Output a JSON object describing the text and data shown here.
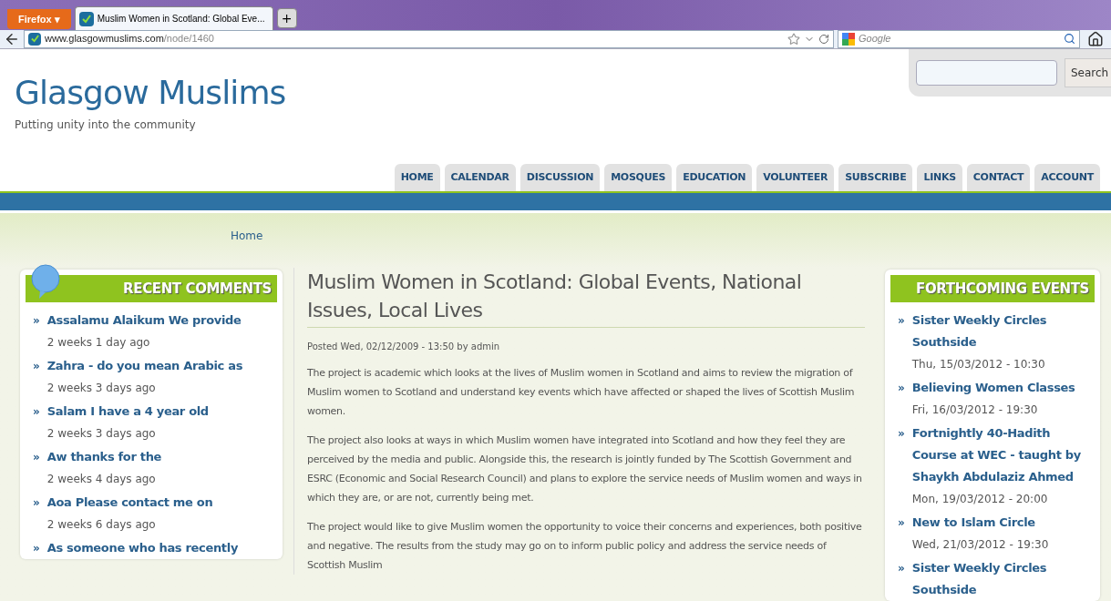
{
  "browser": {
    "menu_button": "Firefox ▾",
    "tabs": [
      {
        "title": "Muslim Women in Scotland: Global Eve...",
        "selected": true
      }
    ],
    "new_tab": "+",
    "url_host": "www.glasgowmuslims.com",
    "url_path": "/node/1460",
    "search_placeholder": "Google"
  },
  "site": {
    "title": "Glasgow Muslims",
    "slogan": "Putting unity into the community",
    "search_button": "Search"
  },
  "nav": [
    {
      "label": "HOME",
      "selected": false
    },
    {
      "label": "CALENDAR",
      "selected": false
    },
    {
      "label": "DISCUSSION",
      "selected": false
    },
    {
      "label": "MOSQUES",
      "selected": false
    },
    {
      "label": "EDUCATION",
      "selected": false
    },
    {
      "label": "VOLUNTEER",
      "selected": false
    },
    {
      "label": "SUBSCRIBE",
      "selected": false
    },
    {
      "label": "LINKS",
      "selected": false
    },
    {
      "label": "CONTACT",
      "selected": false
    },
    {
      "label": "ACCOUNT",
      "selected": false
    }
  ],
  "breadcrumb": "Home",
  "recent_comments": {
    "title": "RECENT COMMENTS",
    "items": [
      {
        "link": "Assalamu Alaikum We provide",
        "meta": "2 weeks 1 day ago"
      },
      {
        "link": "Zahra - do you mean Arabic as",
        "meta": "2 weeks 3 days ago"
      },
      {
        "link": "Salam I have a 4 year old",
        "meta": "2 weeks 3 days ago"
      },
      {
        "link": "Aw thanks for the",
        "meta": "2 weeks 4 days ago"
      },
      {
        "link": "Aoa   Please contact me on",
        "meta": "2 weeks 6 days ago"
      },
      {
        "link": "As someone who has recently"
      }
    ]
  },
  "article": {
    "title": "Muslim Women in Scotland: Global Events, National Issues, Local Lives",
    "posted": "Posted Wed, 02/12/2009 - 13:50 by admin",
    "paragraphs": [
      "The project is academic which looks at the lives of Muslim women in Scotland and aims to review the migration of Muslim women to Scotland and understand key events which have affected or shaped the lives of Scottish Muslim women.",
      "The project also looks at ways in which Muslim women have integrated into Scotland and how they feel they are perceived by the media and public. Alongside this, the research is jointly funded by The Scottish Government and ESRC (Economic and Social Research Council) and plans to explore the service needs of Muslim women and ways in which they are, or are not, currently being met.",
      "The project would like to give Muslim women the opportunity to voice their concerns and experiences, both positive and negative. The results from the study may go on to inform public policy and address the service needs of Scottish Muslim"
    ]
  },
  "events": {
    "title": "FORTHCOMING EVENTS",
    "items": [
      {
        "link": "Sister Weekly Circles Southside",
        "meta": "Thu, 15/03/2012 - 10:30"
      },
      {
        "link": "Believing Women Classes",
        "meta": "Fri, 16/03/2012 - 19:30"
      },
      {
        "link": "Fortnightly 40-Hadith Course at WEC - taught by Shaykh Abdulaziz Ahmed",
        "meta": "Mon, 19/03/2012 - 20:00"
      },
      {
        "link": "New to Islam Circle",
        "meta": "Wed, 21/03/2012 - 19:30"
      },
      {
        "link": "Sister Weekly Circles Southside"
      }
    ]
  },
  "bullet": "»"
}
